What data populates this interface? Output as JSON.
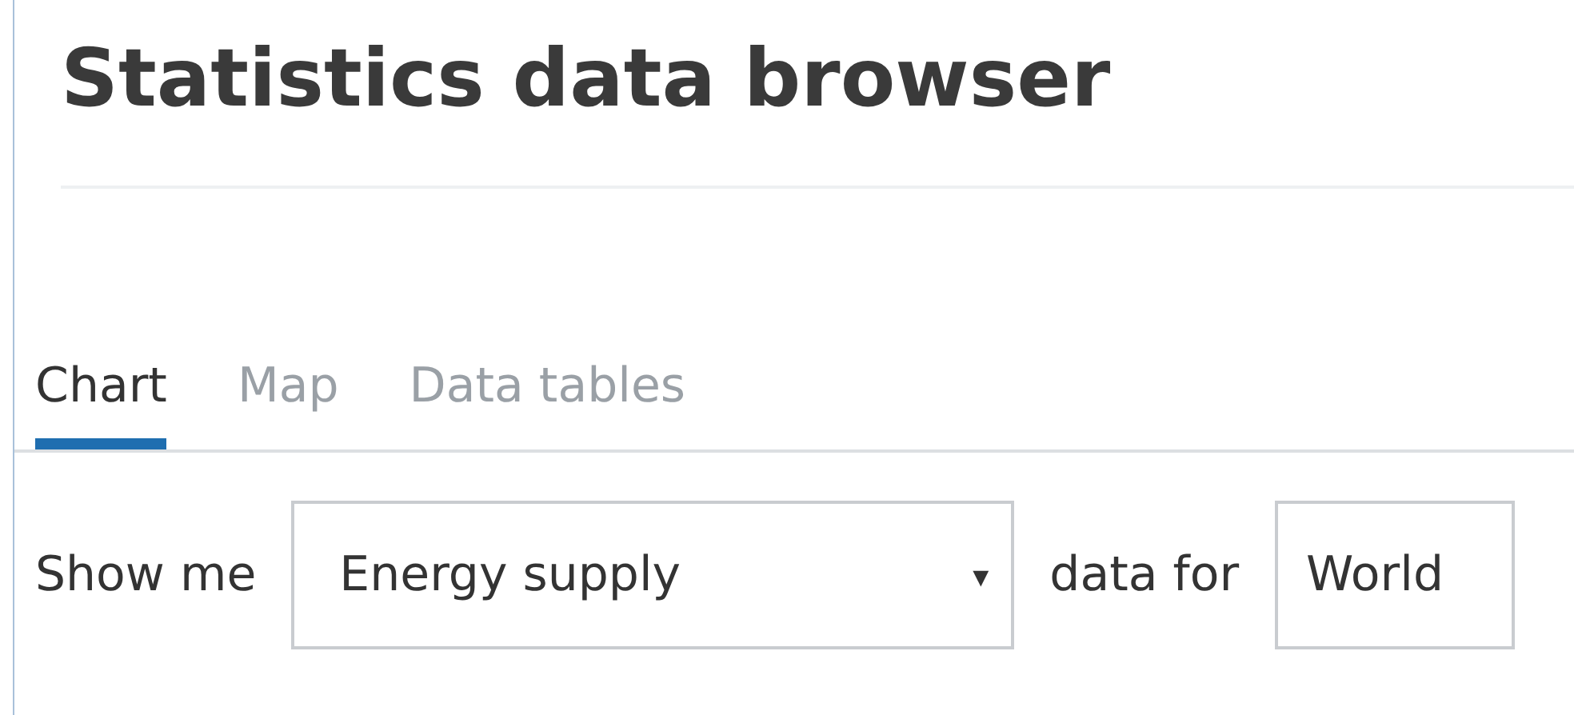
{
  "title": "Statistics data browser",
  "tabs": [
    {
      "label": "Chart",
      "selected": true
    },
    {
      "label": "Map",
      "selected": false
    },
    {
      "label": "Data tables",
      "selected": false
    }
  ],
  "filter": {
    "prefix": "Show me",
    "select": {
      "value": "Energy supply",
      "caret": "▾"
    },
    "middle": "data for",
    "region": {
      "value": "World"
    }
  }
}
